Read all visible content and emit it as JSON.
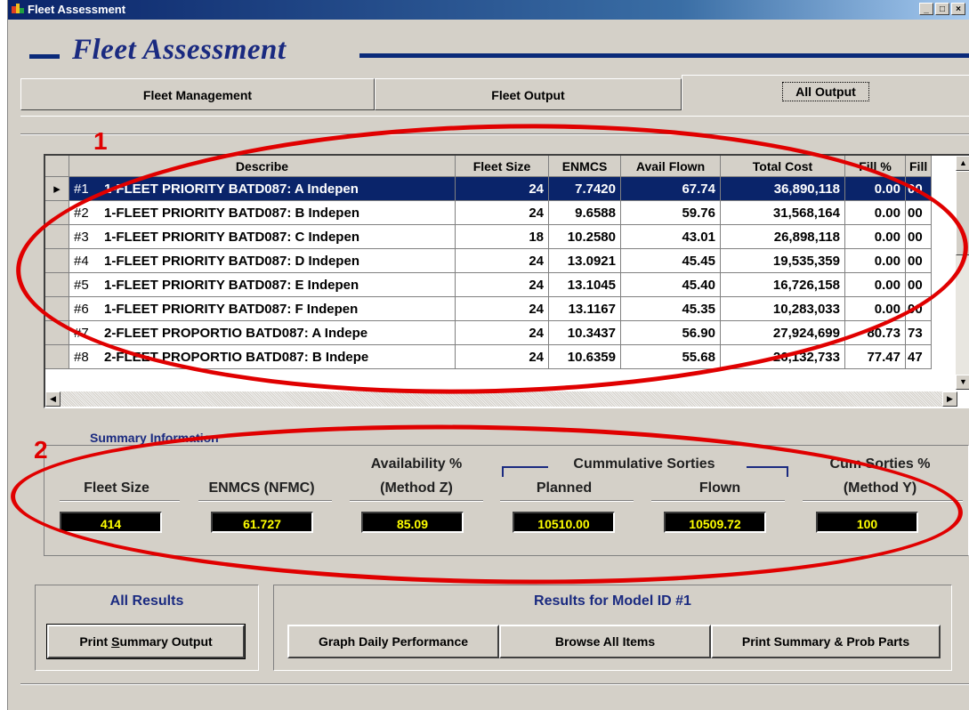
{
  "window": {
    "title": "Fleet Assessment",
    "buttons": {
      "minimize": "_",
      "maximize": "□",
      "close": "×"
    }
  },
  "header": {
    "title": "Fleet Assessment"
  },
  "tabs": [
    {
      "label": "Fleet Management",
      "active": false
    },
    {
      "label": "Fleet Output",
      "active": false
    },
    {
      "label": "All Output",
      "active": true
    }
  ],
  "grid": {
    "columns": [
      "Describe",
      "Fleet Size",
      "ENMCS",
      "Avail Flown",
      "Total Cost",
      "Fill %",
      "Fill"
    ],
    "rows": [
      {
        "id": "#1",
        "describe": "1-FLEET PRIORITY BATD087: A Indepen",
        "fleet_size": "24",
        "enmcs": "7.7420",
        "avail_flown": "67.74",
        "total_cost": "36,890,118",
        "fill_pct": "0.00",
        "fill": "00",
        "selected": true
      },
      {
        "id": "#2",
        "describe": "1-FLEET PRIORITY BATD087: B Indepen",
        "fleet_size": "24",
        "enmcs": "9.6588",
        "avail_flown": "59.76",
        "total_cost": "31,568,164",
        "fill_pct": "0.00",
        "fill": "00",
        "selected": false
      },
      {
        "id": "#3",
        "describe": "1-FLEET PRIORITY BATD087: C Indepen",
        "fleet_size": "18",
        "enmcs": "10.2580",
        "avail_flown": "43.01",
        "total_cost": "26,898,118",
        "fill_pct": "0.00",
        "fill": "00",
        "selected": false
      },
      {
        "id": "#4",
        "describe": "1-FLEET PRIORITY BATD087: D Indepen",
        "fleet_size": "24",
        "enmcs": "13.0921",
        "avail_flown": "45.45",
        "total_cost": "19,535,359",
        "fill_pct": "0.00",
        "fill": "00",
        "selected": false
      },
      {
        "id": "#5",
        "describe": "1-FLEET PRIORITY BATD087: E Indepen",
        "fleet_size": "24",
        "enmcs": "13.1045",
        "avail_flown": "45.40",
        "total_cost": "16,726,158",
        "fill_pct": "0.00",
        "fill": "00",
        "selected": false
      },
      {
        "id": "#6",
        "describe": "1-FLEET PRIORITY BATD087: F Indepen",
        "fleet_size": "24",
        "enmcs": "13.1167",
        "avail_flown": "45.35",
        "total_cost": "10,283,033",
        "fill_pct": "0.00",
        "fill": "00",
        "selected": false
      },
      {
        "id": "#7",
        "describe": "2-FLEET PROPORTIO BATD087: A Indepe",
        "fleet_size": "24",
        "enmcs": "10.3437",
        "avail_flown": "56.90",
        "total_cost": "27,924,699",
        "fill_pct": "80.73",
        "fill": "73",
        "selected": false
      },
      {
        "id": "#8",
        "describe": "2-FLEET PROPORTIO BATD087: B Indepe",
        "fleet_size": "24",
        "enmcs": "10.6359",
        "avail_flown": "55.68",
        "total_cost": "26,132,733",
        "fill_pct": "77.47",
        "fill": "47",
        "selected": false
      }
    ]
  },
  "summary": {
    "legend": "Summary Information",
    "fleet_size_label": "Fleet Size",
    "enmcs_label": "ENMCS (NFMC)",
    "availability_label_1": "Availability %",
    "availability_label_2": "(Method Z)",
    "cum_sorties_header": "Cummulative Sorties",
    "planned_label": "Planned",
    "flown_label": "Flown",
    "cum_pct_label_1": "Cum Sorties %",
    "cum_pct_label_2": "(Method Y)",
    "fleet_size": "414",
    "enmcs": "61.727",
    "availability": "85.09",
    "planned": "10510.00",
    "flown": "10509.72",
    "cum_pct": "100"
  },
  "all_results": {
    "title": "All Results",
    "print_summary_label_pre": "Print ",
    "print_summary_label_u": "S",
    "print_summary_label_post": "ummary Output"
  },
  "model_results": {
    "title": "Results for Model ID #1",
    "graph_label": "Graph Daily Performance",
    "browse_label": "Browse All Items",
    "print_parts_label": "Print Summary & Prob Parts"
  },
  "annotations": {
    "one": "1",
    "two": "2",
    "color": "#e00000"
  }
}
